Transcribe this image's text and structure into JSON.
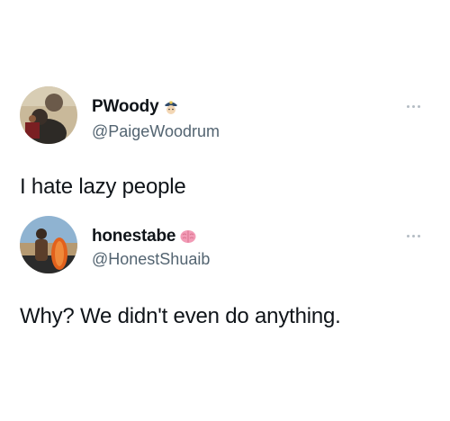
{
  "tweets": [
    {
      "display_name": "PWoody",
      "name_emoji": "police-officer-emoji",
      "handle": "@PaigeWoodrum",
      "text": "I hate lazy people",
      "avatar": "profile-photo-person-with-dog",
      "more_icon": "ellipsis-icon"
    },
    {
      "display_name": "honestabe",
      "name_emoji": "brain-emoji",
      "handle": "@HonestShuaib",
      "text": "Why? We didn't even do anything.",
      "avatar": "profile-photo-man-on-beach-with-surfboard",
      "more_icon": "ellipsis-icon"
    }
  ],
  "colors": {
    "text_primary": "#0f1419",
    "text_secondary": "#536471",
    "icon_muted": "#b4bcc4",
    "background": "#ffffff"
  }
}
